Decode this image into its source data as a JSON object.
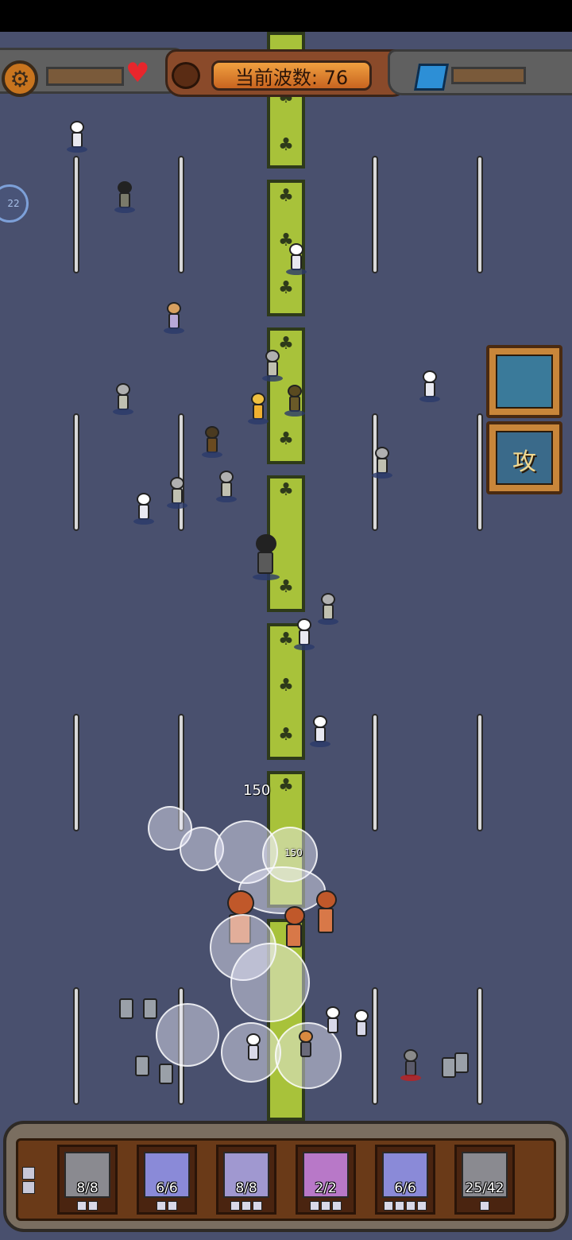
{
  "hud": {
    "wave_label": "当前波数: 76",
    "settings_icon": "gear-icon",
    "health_icon": "heart-icon",
    "resource_icon": "blue-gem-icon",
    "side_badge": "22"
  },
  "damage_numbers": [
    "150",
    "150"
  ],
  "cards": {
    "attack_label": "攻"
  },
  "units_bar": [
    {
      "count": "8/8",
      "color": "#8a8a90"
    },
    {
      "count": "6/6",
      "color": "#8a8ad8"
    },
    {
      "count": "8/8",
      "color": "#a098d0"
    },
    {
      "count": "2/2",
      "color": "#b878c8"
    },
    {
      "count": "6/6",
      "color": "#8a8ad8"
    },
    {
      "count": "25/42",
      "color": "#8a8a90"
    }
  ],
  "colors": {
    "background": "#49506e",
    "road": "#a8c23a",
    "wave_panel": "#8a4a2a"
  }
}
